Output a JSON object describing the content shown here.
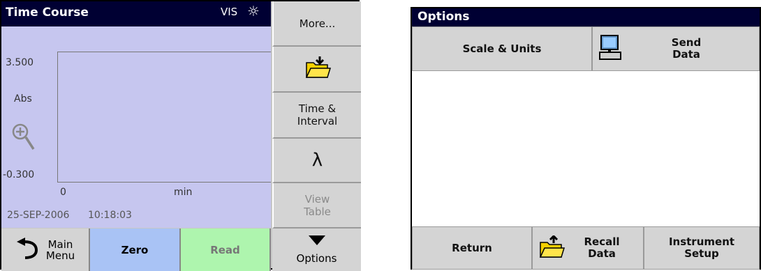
{
  "left_screen": {
    "title": "Time Course",
    "lamp": "VIS",
    "lamp_icon": "sun-icon",
    "graph": {
      "y_max": "3.500",
      "y_unit": "Abs",
      "y_min": "-0.300",
      "x_min": "0",
      "x_unit": "min",
      "date": "25-SEP-2006",
      "time": "10:18:03"
    },
    "side_buttons": {
      "more": "More...",
      "store_icon": "folder-store-icon",
      "time_interval_1": "Time &",
      "time_interval_2": "Interval",
      "lambda": "λ",
      "view_table_1": "View",
      "view_table_2": "Table"
    },
    "bottom_buttons": {
      "main_menu_1": "Main",
      "main_menu_2": "Menu",
      "zero": "Zero",
      "read": "Read",
      "options": "Options"
    }
  },
  "right_screen": {
    "title": "Options",
    "scale_units": "Scale & Units",
    "send_data_1": "Send",
    "send_data_2": "Data",
    "return": "Return",
    "recall_data_1": "Recall",
    "recall_data_2": "Data",
    "instrument_setup_1": "Instrument",
    "instrument_setup_2": "Setup"
  },
  "colors": {
    "title_bar": "#000033",
    "graph_bg": "#c6c6ef",
    "zero_btn": "#a9c3f5",
    "read_btn": "#aef5ae"
  }
}
